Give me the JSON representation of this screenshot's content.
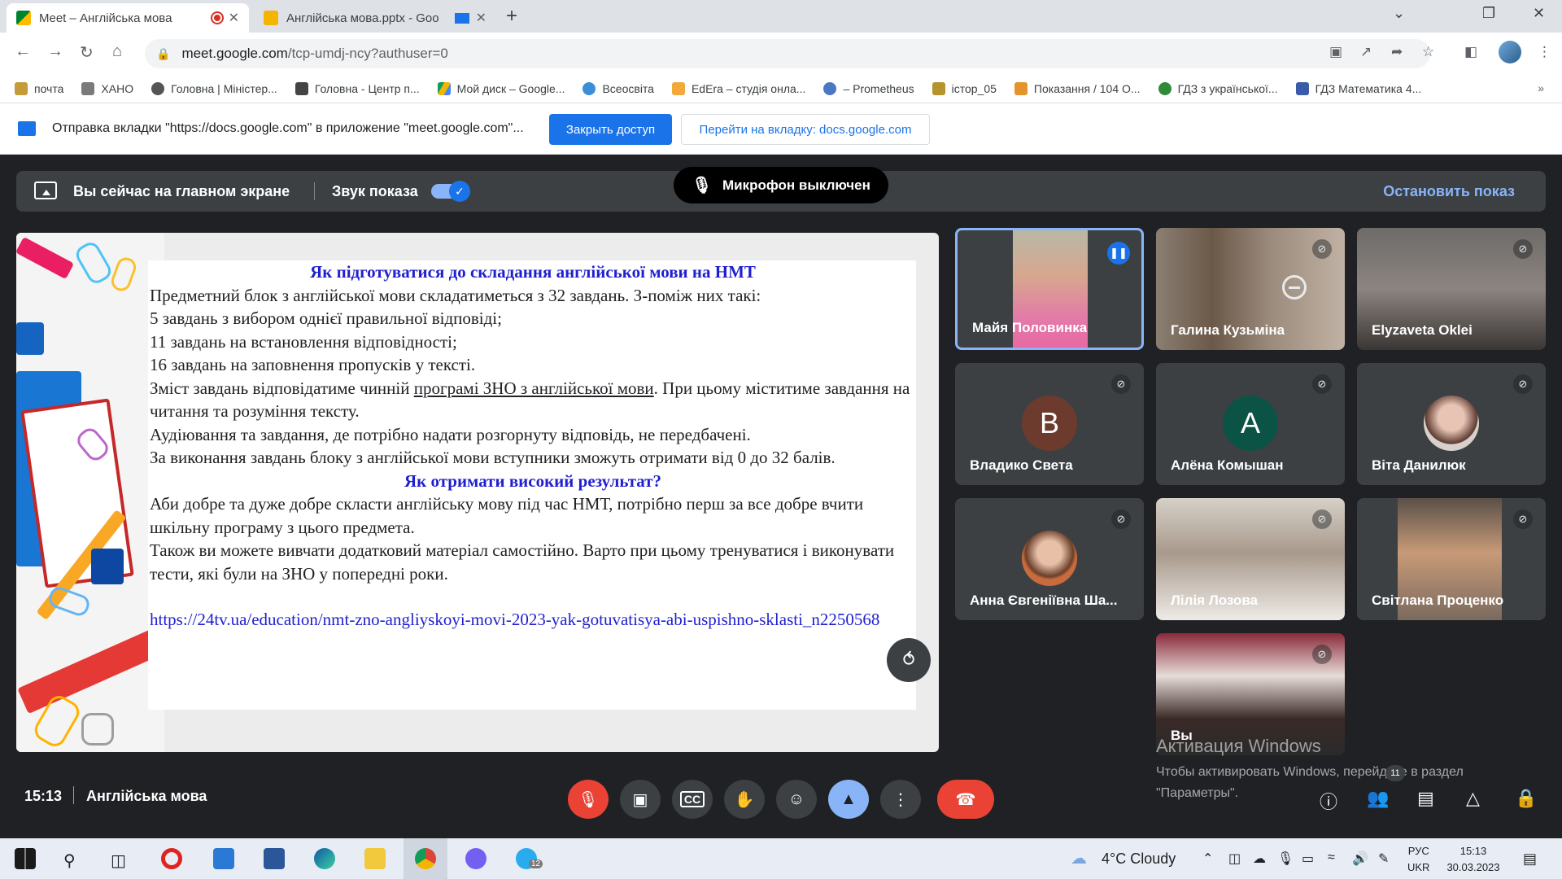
{
  "browser": {
    "tabs": [
      {
        "title": "Meet – Англійська мова",
        "close": "✕"
      },
      {
        "title": "Англійська мова.pptx - Goo",
        "close": "✕"
      }
    ],
    "new_tab": "+",
    "window": {
      "minimize": "⌄",
      "restore": "❐",
      "close": "✕"
    },
    "nav": {
      "back": "←",
      "forward": "→",
      "reload": "↻",
      "home": "⌂"
    },
    "url_host": "meet.google.com",
    "url_path": "/tcp-umdj-ncy?authuser=0",
    "bookmarks": [
      {
        "label": "почта",
        "color": "#c49a3b"
      },
      {
        "label": "ХАНО",
        "color": "#7a7a7a"
      },
      {
        "label": "Головна | Міністер...",
        "color": "#555555"
      },
      {
        "label": "Головна - Центр п...",
        "color": "#444444"
      },
      {
        "label": "Мой диск – Google...",
        "color": "#f4b400"
      },
      {
        "label": "Всеосвіта",
        "color": "#3b8fd9"
      },
      {
        "label": "EdEra – студія онла...",
        "color": "#f2a93b"
      },
      {
        "label": "– Prometheus",
        "color": "#4a78c2"
      },
      {
        "label": "істор_05",
        "color": "#b6932c"
      },
      {
        "label": "Показання / 104 О...",
        "color": "#e3942b"
      },
      {
        "label": "ГДЗ з української...",
        "color": "#2f8a3a"
      },
      {
        "label": "ГДЗ Математика 4...",
        "color": "#3a5ca8"
      }
    ],
    "bookmarks_more": "»"
  },
  "infobar": {
    "message": "Отправка вкладки \"https://docs.google.com\" в приложение \"meet.google.com\"...",
    "stop_button": "Закрыть доступ",
    "switch_button": "Перейти на вкладку: docs.google.com"
  },
  "presenting": {
    "status": "Вы сейчас на главном экране",
    "audio_label": "Звук показа",
    "mic_off": "Микрофон выключен",
    "stop_link": "Остановить показ"
  },
  "slide": {
    "heading1": "Як підготуватися до складання англійської мови на НМТ",
    "line1": "Предметний блок з англійської мови складатиметься з 32 завдань. З-поміж них такі:",
    "line2": "5 завдань з вибором однієї правильної відповіді;",
    "line3": "11 завдань на встановлення відповідності;",
    "line4": "16 завдань на заповнення пропусків у тексті.",
    "line5a": "Зміст завдань відповідатиме чинній ",
    "line5_link": "програмі ЗНО з англійської мови",
    "line5b": ". При цьому міститиме завдання на читання та розуміння тексту.",
    "line6": "Аудіювання та завдання, де потрібно надати розгорнуту відповідь, не передбачені.",
    "line7": "За виконання завдань блоку з англійської мови вступники зможуть отримати від 0 до 32 балів.",
    "heading2": "Як отримати високий результат?",
    "line8": "Аби добре та дуже добре скласти англійську мову під час НМТ, потрібно перш за все добре вчити шкільну програму з цього предмета.",
    "line9": "Також ви можете вивчати додатковий матеріал самостійно. Варто при цьому тренуватися і виконувати тести, які були на ЗНО у попередні роки.",
    "url": "https://24tv.ua/education/nmt-zno-angliyskoyi-movi-2023-yak-gotuvatisya-abi-uspishno-sklasti_n2250568"
  },
  "participants": [
    {
      "name": "Майя Половинка",
      "speaking": true
    },
    {
      "name": "Галина Кузьміна"
    },
    {
      "name": "Elyzaveta Oklei"
    },
    {
      "name": "Владико Света",
      "initial": "B",
      "color": "#6d3b2e"
    },
    {
      "name": "Алёна Комышан",
      "initial": "A",
      "color": "#0b5345"
    },
    {
      "name": "Віта Данилюк"
    },
    {
      "name": "Анна Євгеніївна Ша..."
    },
    {
      "name": "Лілія Лозова"
    },
    {
      "name": "Світлана Проценко"
    },
    {
      "name": "Вы"
    }
  ],
  "watermark": {
    "title": "Активация Windows",
    "line1": "Чтобы активировать Windows, перейдите в раздел",
    "line2": "\"Параметры\"."
  },
  "meeting": {
    "time": "15:13",
    "name": "Англійська мова",
    "participants_count": "11"
  },
  "taskbar": {
    "weather": "4°C  Cloudy",
    "lang1": "РУС",
    "lang2": "UKR",
    "time": "15:13",
    "date": "30.03.2023",
    "telegram_badge": "12"
  },
  "colors": {
    "accent": "#1a73e8",
    "meet_bg": "#202124",
    "danger": "#ea4335",
    "slide_heading": "#1f1fcf"
  }
}
